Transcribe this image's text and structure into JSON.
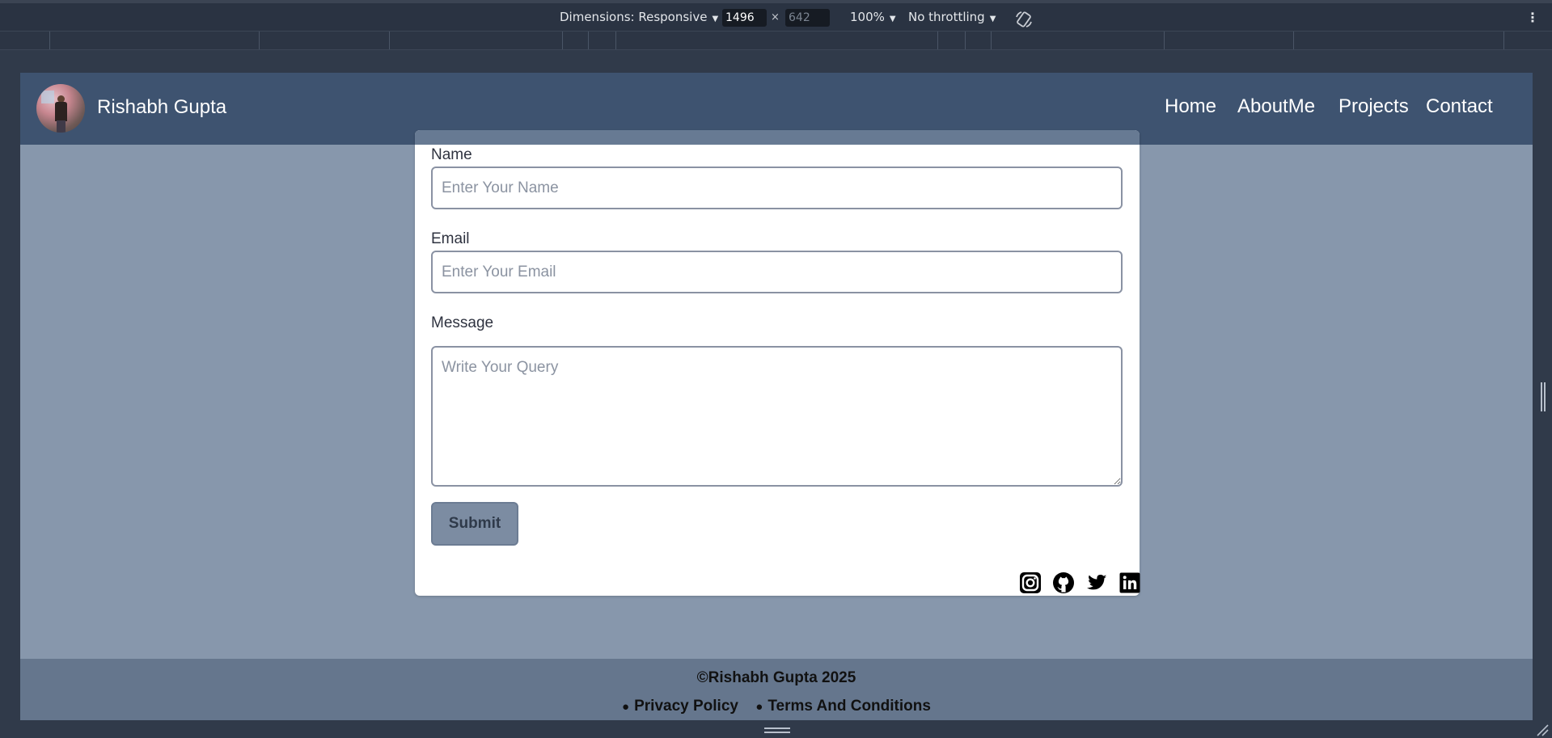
{
  "devtools": {
    "dimensions_label": "Dimensions: Responsive",
    "width_value": "1496",
    "height_placeholder": "642",
    "times": "×",
    "zoom_label": "100%",
    "throttle_label": "No throttling",
    "more": "⋮"
  },
  "navbar": {
    "brand": "Rishabh Gupta",
    "links": [
      "Home",
      "AboutMe",
      "Projects",
      "Contact"
    ]
  },
  "form": {
    "name_label": "Name",
    "name_placeholder": "Enter Your Name",
    "email_label": "Email",
    "email_placeholder": "Enter Your Email",
    "message_label": "Message",
    "message_placeholder": "Write Your Query",
    "submit_label": "Submit"
  },
  "social": [
    "instagram-icon",
    "github-icon",
    "twitter-icon",
    "linkedin-icon"
  ],
  "footer": {
    "copyright": "©Rishabh Gupta 2025",
    "links": [
      "Privacy Policy",
      "Terms And Conditions"
    ],
    "bullet": "●"
  }
}
